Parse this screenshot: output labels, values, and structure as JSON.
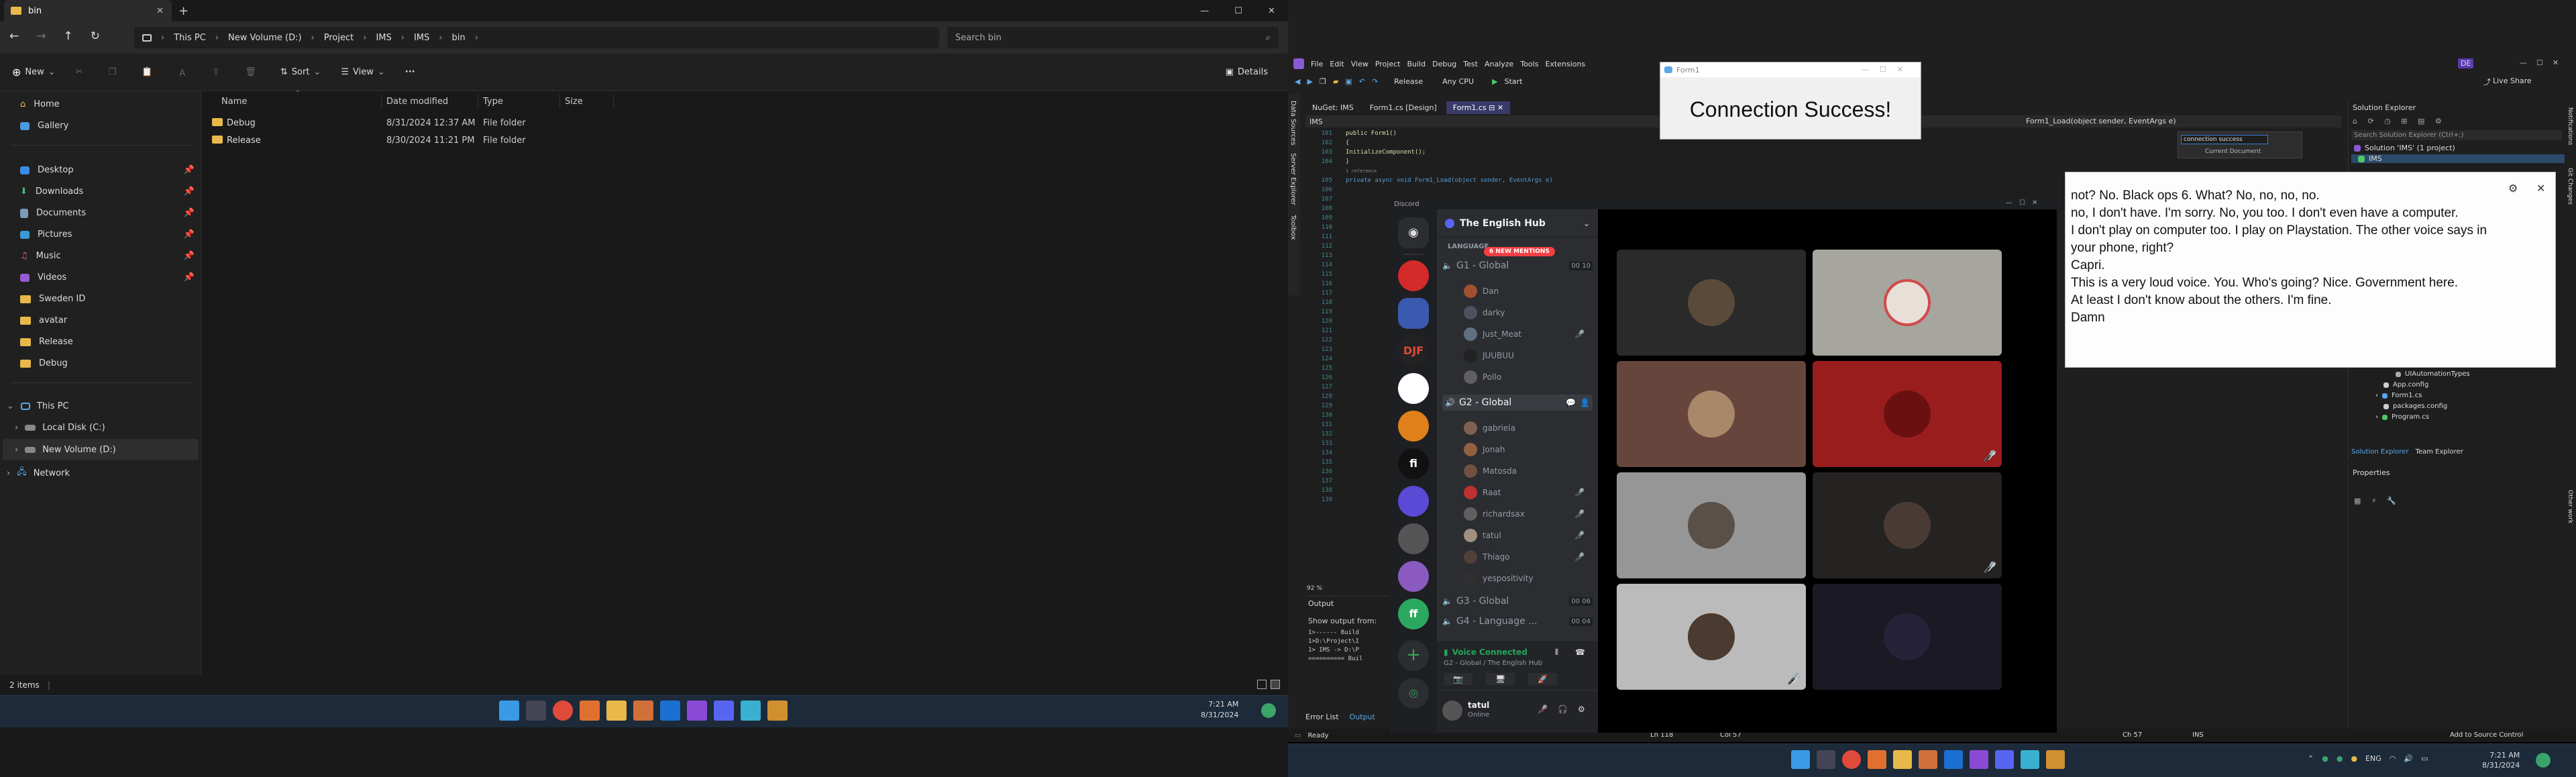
{
  "explorer": {
    "tab_title": "bin",
    "new_label": "New",
    "sort_label": "Sort",
    "view_label": "View",
    "details_label": "Details",
    "more_label": "···",
    "breadcrumb": [
      "This PC",
      "New Volume (D:)",
      "Project",
      "IMS",
      "IMS",
      "bin"
    ],
    "search_placeholder": "Search bin",
    "nav_quick": [
      {
        "label": "Home"
      },
      {
        "label": "Gallery"
      }
    ],
    "nav_pinned": [
      {
        "label": "Desktop"
      },
      {
        "label": "Downloads"
      },
      {
        "label": "Documents"
      },
      {
        "label": "Pictures"
      },
      {
        "label": "Music"
      },
      {
        "label": "Videos"
      },
      {
        "label": "Sweden ID"
      },
      {
        "label": "avatar"
      },
      {
        "label": "Release"
      },
      {
        "label": "Debug"
      }
    ],
    "nav_pc": [
      "This PC",
      "Local Disk (C:)",
      "New Volume (D:)",
      "Network"
    ],
    "columns": [
      "Name",
      "Date modified",
      "Type",
      "Size"
    ],
    "files": [
      {
        "name": "Debug",
        "date": "8/31/2024 12:37 AM",
        "type": "File folder",
        "size": ""
      },
      {
        "name": "Release",
        "date": "8/30/2024 11:21 PM",
        "type": "File folder",
        "size": ""
      }
    ],
    "status": "2 items"
  },
  "taskbar_left": {
    "time": "7:21 AM",
    "date": "8/31/2024"
  },
  "vs": {
    "menu": [
      "File",
      "Edit",
      "View",
      "Project",
      "Build",
      "Debug",
      "Test",
      "Analyze",
      "Tools",
      "Extensions"
    ],
    "toolbar": {
      "config": "Release",
      "platform": "Any CPU",
      "start": "Start"
    },
    "live_share": "Live Share",
    "avatar": "DE",
    "tabs": [
      "NuGet: IMS",
      "Form1.cs [Design]",
      "Form1.cs"
    ],
    "project_dd": "IMS",
    "method_dd": "Form1_Load(object sender, EventArgs e)",
    "side_tabs": [
      "Data Sources",
      "Server Explorer",
      "Toolbox"
    ],
    "code_lines": [
      {
        "n": "101",
        "t": "public Form1()"
      },
      {
        "n": "102",
        "t": "{"
      },
      {
        "n": "103",
        "t": "    InitializeComponent();"
      },
      {
        "n": "104",
        "t": "}"
      },
      {
        "n": "",
        "t": "1 reference"
      },
      {
        "n": "105",
        "t": "private async void Form1_Load(object sender, EventArgs e)"
      }
    ],
    "line_numbers": [
      "106",
      "107",
      "108",
      "109",
      "110",
      "111",
      "112",
      "113",
      "114",
      "115",
      "116",
      "117",
      "118",
      "119",
      "120",
      "121",
      "122",
      "123",
      "124",
      "125",
      "126",
      "127",
      "128",
      "129",
      "130",
      "131",
      "132",
      "133",
      "134",
      "135",
      "136",
      "137",
      "138",
      "139"
    ],
    "zoom": "92 %",
    "find": {
      "value": "connection success",
      "scope": "Current Document"
    },
    "output": {
      "title": "Output",
      "show_from": "Show output from:",
      "lines": [
        "1>------ Build",
        "1>D:\\Project\\I",
        "1>  IMS -> D:\\P",
        "========== Buil"
      ]
    },
    "bottom_tabs": [
      "Error List",
      "Output"
    ],
    "status": {
      "ready": "Ready",
      "ln": "Ln 118",
      "col": "Col 57",
      "ch": "Ch 57",
      "ins": "INS",
      "source": "Add to Source Control"
    },
    "solution": {
      "title": "Solution Explorer",
      "search": "Search Solution Explorer (Ctrl+;)",
      "root": "Solution 'IMS' (1 project)",
      "project": "IMS",
      "items": [
        "UIAutomationTypes",
        "App.config",
        "Form1.cs",
        "packages.config",
        "Program.cs"
      ],
      "tabs": [
        "Solution Explorer",
        "Team Explorer"
      ]
    },
    "properties_title": "Properties",
    "right_rail": [
      "Notifications",
      "Git Changes",
      "Other work"
    ]
  },
  "form1": {
    "title": "Form1",
    "message": "Connection Success!"
  },
  "discord": {
    "title": "Discord",
    "server": "The English Hub",
    "category": "LANGUAGE",
    "mentions": "6 NEW MENTIONS",
    "channels": [
      {
        "name": "G1 - Global",
        "count": "00",
        "limit": "10",
        "users": [
          "Dan",
          "darky",
          "Just_Meat",
          "JUUBUU",
          "Pollo"
        ]
      },
      {
        "name": "G2 - Global",
        "count": "",
        "limit": "",
        "users": [
          "gabriela",
          "Jonah",
          "Matosda",
          "Raat",
          "richardsax",
          "tatul",
          "Thiago",
          "yespositivity"
        ]
      },
      {
        "name": "G3 - Global",
        "count": "00",
        "limit": "06",
        "users": []
      },
      {
        "name": "G4 - Language ...",
        "count": "00",
        "limit": "04",
        "users": []
      }
    ],
    "voice_connected": "Voice Connected",
    "voice_channel": "G2 - Global / The English Hub",
    "user": {
      "name": "tatul",
      "status": "Online"
    }
  },
  "captions": {
    "lines": [
      "not? No. Black ops 6. What? No, no, no, no.",
      "no, I don't have. I'm sorry. No, you too. I don't even have a computer.",
      "I don't play on computer too. I play on Playstation. The other voice says in your phone, right?",
      "Capri.",
      "This is a very loud voice. You. Who's going? Nice. Government here.",
      "At least I don't know about the others. I'm fine.",
      "Damn"
    ]
  },
  "taskbar_right": {
    "time": "7:21 AM",
    "date": "8/31/2024",
    "lang": "ENG"
  }
}
